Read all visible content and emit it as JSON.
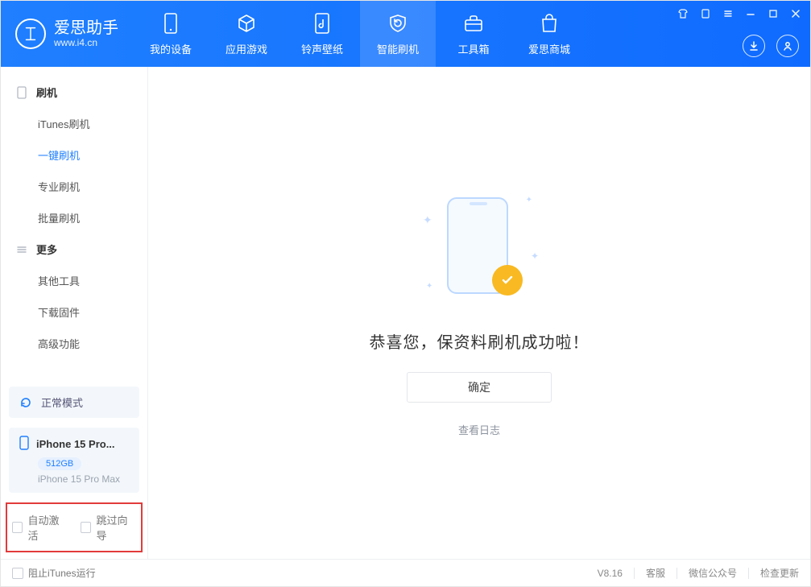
{
  "brand": {
    "title": "爱思助手",
    "subtitle": "www.i4.cn"
  },
  "nav": {
    "items": [
      {
        "label": "我的设备"
      },
      {
        "label": "应用游戏"
      },
      {
        "label": "铃声壁纸"
      },
      {
        "label": "智能刷机"
      },
      {
        "label": "工具箱"
      },
      {
        "label": "爱思商城"
      }
    ],
    "active_index": 3
  },
  "sidebar": {
    "group1": {
      "label": "刷机"
    },
    "items1": [
      {
        "label": "iTunes刷机"
      },
      {
        "label": "一键刷机"
      },
      {
        "label": "专业刷机"
      },
      {
        "label": "批量刷机"
      }
    ],
    "active1_index": 1,
    "group2": {
      "label": "更多"
    },
    "items2": [
      {
        "label": "其他工具"
      },
      {
        "label": "下载固件"
      },
      {
        "label": "高级功能"
      }
    ],
    "mode": {
      "label": "正常模式"
    },
    "device": {
      "name": "iPhone 15 Pro...",
      "capacity": "512GB",
      "full_name": "iPhone 15 Pro Max"
    },
    "checkboxes": {
      "auto_activate": "自动激活",
      "skip_wizard": "跳过向导"
    }
  },
  "main": {
    "message": "恭喜您，保资料刷机成功啦！",
    "ok_label": "确定",
    "log_link": "查看日志"
  },
  "statusbar": {
    "block_itunes": "阻止iTunes运行",
    "version": "V8.16",
    "support": "客服",
    "wechat": "微信公众号",
    "check_update": "检查更新"
  }
}
